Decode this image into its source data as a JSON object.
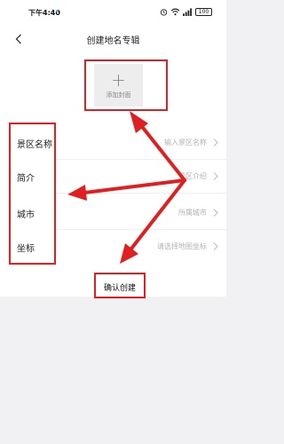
{
  "status_bar": {
    "time": "下午4:40",
    "battery": "100"
  },
  "header": {
    "title": "创建地名专辑"
  },
  "cover": {
    "label": "添加封面"
  },
  "form": {
    "rows": [
      {
        "label": "景区名称",
        "value": "输入景区名称"
      },
      {
        "label": "简介",
        "value": "景区介绍"
      },
      {
        "label": "城市",
        "value": "所属城市"
      },
      {
        "label": "坐标",
        "value": "请选择地图坐标"
      }
    ]
  },
  "confirm": {
    "label": "确认创建"
  },
  "colors": {
    "annotation": "#e02020",
    "placeholder": "#b2b2b2"
  }
}
